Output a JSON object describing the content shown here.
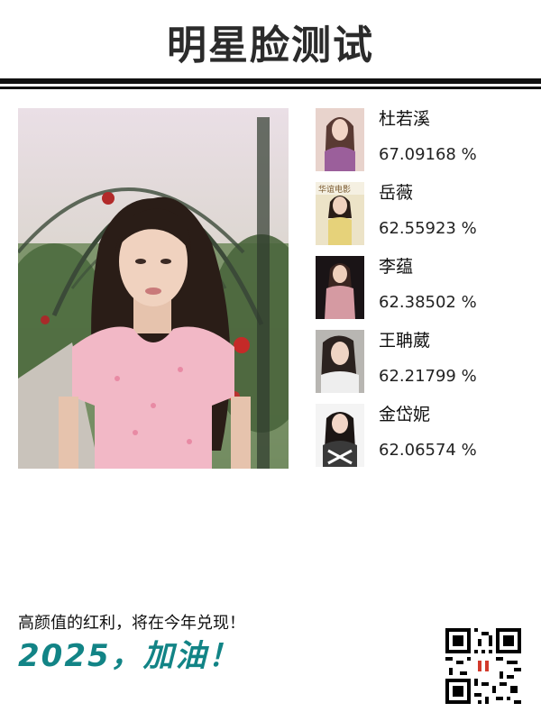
{
  "header": {
    "title": "明星脸测试"
  },
  "matches": [
    {
      "name": "杜若溪",
      "score": "67.09168 %"
    },
    {
      "name": "岳薇",
      "score": "62.55923 %"
    },
    {
      "name": "李蕴",
      "score": "62.38502 %"
    },
    {
      "name": "王聃葳",
      "score": "62.21799 %"
    },
    {
      "name": "金岱妮",
      "score": "62.06574 %"
    }
  ],
  "footer": {
    "text": "高颜值的红利，将在今年兑现！",
    "slogan": "2025，加油！"
  },
  "thumb_overlay_text": "华谊电影",
  "colors": {
    "accent": "#128486",
    "rule": "#111111",
    "dress": "#f2b8c6"
  }
}
